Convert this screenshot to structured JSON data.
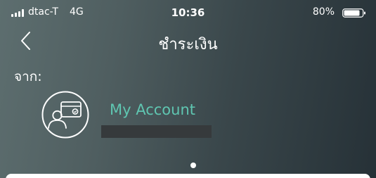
{
  "status_bar": {
    "carrier": "dtac-T",
    "network": "4G",
    "time": "10:36",
    "battery_percent": "80%"
  },
  "nav": {
    "back_icon": "chevron-left-icon",
    "title": "ชำระเงิน"
  },
  "from_section": {
    "label": "จาก:",
    "account": {
      "icon": "card-user-icon",
      "name": "My Account",
      "number_redacted": true
    }
  },
  "pager": {
    "page_count": 1,
    "current_page": 1
  },
  "colors": {
    "accent": "#5fc6b1",
    "header_start": "#5d6e6f",
    "header_end": "#263137",
    "text": "#ffffff"
  }
}
